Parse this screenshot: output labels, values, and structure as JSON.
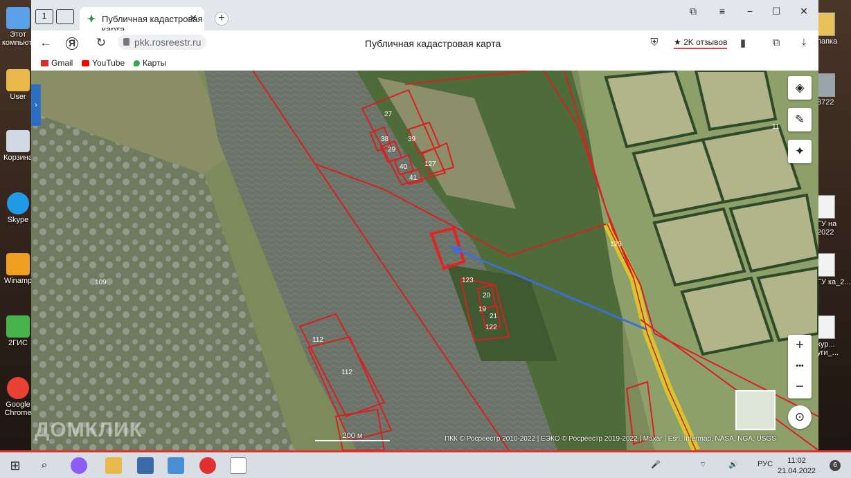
{
  "desktop": {
    "left_icons": [
      {
        "label": "Этот компьютер",
        "color": "#5aa0e8"
      },
      {
        "label": "User",
        "color": "#e8b84a"
      },
      {
        "label": "Корзина",
        "color": "#cfd8e3"
      },
      {
        "label": "Skype",
        "color": "#1f9ce5"
      },
      {
        "label": "Winamp",
        "color": "#f0a020"
      },
      {
        "label": "2ГИС",
        "color": "#46b34b"
      },
      {
        "label": "Google Chrome",
        "color": "#e94235"
      }
    ],
    "right_icons": [
      {
        "label": "папка"
      },
      {
        "label": "3722"
      },
      {
        "label": "ГУ на 2022"
      },
      {
        "label": "ГУ ка_2..."
      },
      {
        "label": "кур... уги_..."
      }
    ]
  },
  "browser": {
    "tab_title": "Публичная кадастровая карта",
    "tab_count": "1",
    "address": "pkk.rosreestr.ru",
    "page_title": "Публичная кадастровая карта",
    "reviews": "2K отзывов",
    "bookmarks": [
      {
        "label": "Gmail",
        "color": "#d93025"
      },
      {
        "label": "YouTube",
        "color": "#ff0000"
      },
      {
        "label": "Карты",
        "color": "#34a853"
      }
    ]
  },
  "map": {
    "parcel_labels": [
      "27",
      "39",
      "38",
      "29",
      "40",
      "127",
      "41",
      "123",
      "20",
      "19",
      "21",
      "122",
      "109",
      "112",
      "112",
      "11",
      "123"
    ],
    "scale_label": "200 м",
    "attribution": "ПКК © Росреестр 2010-2022 | ЕЭКО © Росреестр 2019-2022 | Maxar | Esri, Intermap, NASA, NGA, USGS",
    "watermark": "ДОМКЛИК",
    "controls": [
      "layers-icon",
      "ruler-icon",
      "locate-icon"
    ],
    "zoom_in": "+",
    "zoom_more": "•••",
    "zoom_out": "−"
  },
  "taskbar": {
    "lang": "РУС",
    "time": "11:02",
    "date": "21.04.2022",
    "notifications": "6"
  }
}
